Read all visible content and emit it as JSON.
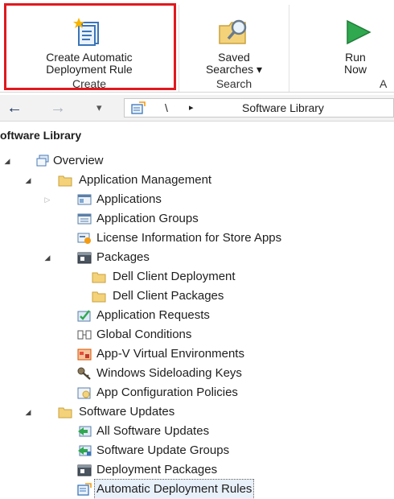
{
  "ribbon": {
    "create_group": {
      "button_line1": "Create Automatic",
      "button_line2": "Deployment Rule",
      "group_label": "Create"
    },
    "search_group": {
      "button_line1": "Saved",
      "button_line2": "Searches ▾",
      "group_label": "Search"
    },
    "run_group": {
      "button_line1": "Run",
      "button_line2": "Now",
      "group_label_partial": "A"
    }
  },
  "address_bar": {
    "back": "←",
    "forward": "→",
    "dropdown": "▾",
    "separator": "\\",
    "arrow": "▸",
    "path": "Software Library"
  },
  "pane_title": "oftware Library",
  "tree": {
    "overview": "Overview",
    "app_mgmt": "Application Management",
    "applications": "Applications",
    "app_groups": "Application Groups",
    "license_info": "License Information for Store Apps",
    "packages": "Packages",
    "dell_client_deployment": "Dell Client Deployment",
    "dell_client_packages": "Dell Client Packages",
    "app_requests": "Application Requests",
    "global_conditions": "Global Conditions",
    "appv_envs": "App-V Virtual Environments",
    "sideloading_keys": "Windows Sideloading Keys",
    "app_config_policies": "App Configuration Policies",
    "software_updates": "Software Updates",
    "all_software_updates": "All Software Updates",
    "software_update_groups": "Software Update Groups",
    "deployment_packages": "Deployment Packages",
    "automatic_deployment_rules": "Automatic Deployment Rules"
  },
  "icons": {
    "expanded": "expanded-triangle-icon",
    "collapsed": "collapsed-triangle-icon"
  },
  "colors": {
    "highlight_box": "#e0191e",
    "folder": "#f3d27a",
    "run_green": "#2fa84f"
  }
}
